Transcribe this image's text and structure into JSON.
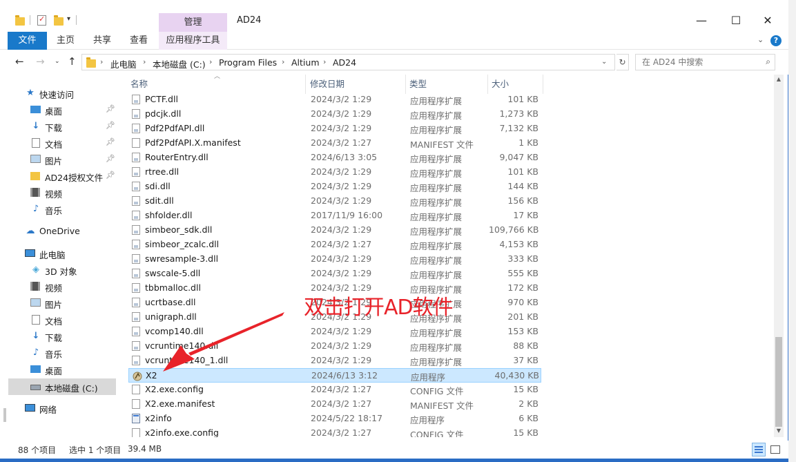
{
  "window": {
    "title": "AD24",
    "manage_tab": "管理",
    "minimize": "—",
    "maximize": "☐",
    "close": "✕"
  },
  "ribbon": {
    "tabs": [
      "文件",
      "主页",
      "共享",
      "查看"
    ],
    "app_tools": "应用程序工具",
    "help": "?"
  },
  "address": {
    "crumbs": [
      "此电脑",
      "本地磁盘 (C:)",
      "Program Files",
      "Altium",
      "AD24"
    ],
    "search_placeholder": "在 AD24 中搜索"
  },
  "navpane": {
    "items": [
      {
        "label": "快速访问",
        "icon": "star-icon"
      },
      {
        "label": "桌面",
        "icon": "desktop-icon"
      },
      {
        "label": "下载",
        "icon": "download-icon"
      },
      {
        "label": "文档",
        "icon": "document-icon"
      },
      {
        "label": "图片",
        "icon": "picture-icon"
      },
      {
        "label": "AD24授权文件",
        "icon": "folder-icon"
      },
      {
        "label": "视频",
        "icon": "video-icon"
      },
      {
        "label": "音乐",
        "icon": "music-icon"
      },
      {
        "label": "OneDrive",
        "icon": "cloud-icon"
      },
      {
        "label": "此电脑",
        "icon": "computer-icon"
      },
      {
        "label": "3D 对象",
        "icon": "cube-icon"
      },
      {
        "label": "视频",
        "icon": "video-icon"
      },
      {
        "label": "图片",
        "icon": "picture-icon"
      },
      {
        "label": "文档",
        "icon": "document-icon"
      },
      {
        "label": "下载",
        "icon": "download-icon"
      },
      {
        "label": "音乐",
        "icon": "music-icon"
      },
      {
        "label": "桌面",
        "icon": "desktop-icon"
      },
      {
        "label": "本地磁盘 (C:)",
        "icon": "drive-icon"
      },
      {
        "label": "网络",
        "icon": "network-icon"
      }
    ]
  },
  "columns": {
    "name": "名称",
    "date": "修改日期",
    "type": "类型",
    "size": "大小"
  },
  "files": [
    {
      "name": "PCTF.dll",
      "date": "2024/3/2 1:29",
      "type": "应用程序扩展",
      "size": "101 KB",
      "kind": "dll"
    },
    {
      "name": "pdcjk.dll",
      "date": "2024/3/2 1:29",
      "type": "应用程序扩展",
      "size": "1,273 KB",
      "kind": "dll"
    },
    {
      "name": "Pdf2PdfAPI.dll",
      "date": "2024/3/2 1:29",
      "type": "应用程序扩展",
      "size": "7,132 KB",
      "kind": "dll"
    },
    {
      "name": "Pdf2PdfAPI.X.manifest",
      "date": "2024/3/2 1:27",
      "type": "MANIFEST 文件",
      "size": "1 KB",
      "kind": "file"
    },
    {
      "name": "RouterEntry.dll",
      "date": "2024/6/13 3:05",
      "type": "应用程序扩展",
      "size": "9,047 KB",
      "kind": "dll"
    },
    {
      "name": "rtree.dll",
      "date": "2024/3/2 1:29",
      "type": "应用程序扩展",
      "size": "101 KB",
      "kind": "dll"
    },
    {
      "name": "sdi.dll",
      "date": "2024/3/2 1:29",
      "type": "应用程序扩展",
      "size": "144 KB",
      "kind": "dll"
    },
    {
      "name": "sdit.dll",
      "date": "2024/3/2 1:29",
      "type": "应用程序扩展",
      "size": "156 KB",
      "kind": "dll"
    },
    {
      "name": "shfolder.dll",
      "date": "2017/11/9 16:00",
      "type": "应用程序扩展",
      "size": "17 KB",
      "kind": "dll"
    },
    {
      "name": "simbeor_sdk.dll",
      "date": "2024/3/2 1:29",
      "type": "应用程序扩展",
      "size": "109,766 KB",
      "kind": "dll"
    },
    {
      "name": "simbeor_zcalc.dll",
      "date": "2024/3/2 1:27",
      "type": "应用程序扩展",
      "size": "4,153 KB",
      "kind": "dll"
    },
    {
      "name": "swresample-3.dll",
      "date": "2024/3/2 1:29",
      "type": "应用程序扩展",
      "size": "333 KB",
      "kind": "dll"
    },
    {
      "name": "swscale-5.dll",
      "date": "2024/3/2 1:29",
      "type": "应用程序扩展",
      "size": "555 KB",
      "kind": "dll"
    },
    {
      "name": "tbbmalloc.dll",
      "date": "2024/3/2 1:29",
      "type": "应用程序扩展",
      "size": "172 KB",
      "kind": "dll"
    },
    {
      "name": "ucrtbase.dll",
      "date": "2024/3/2 1:29",
      "type": "应用程序扩展",
      "size": "970 KB",
      "kind": "dll"
    },
    {
      "name": "unigraph.dll",
      "date": "2024/3/2 1:29",
      "type": "应用程序扩展",
      "size": "201 KB",
      "kind": "dll"
    },
    {
      "name": "vcomp140.dll",
      "date": "2024/3/2 1:29",
      "type": "应用程序扩展",
      "size": "153 KB",
      "kind": "dll"
    },
    {
      "name": "vcruntime140.dll",
      "date": "2024/3/2 1:29",
      "type": "应用程序扩展",
      "size": "88 KB",
      "kind": "dll"
    },
    {
      "name": "vcruntime140_1.dll",
      "date": "2024/3/2 1:29",
      "type": "应用程序扩展",
      "size": "37 KB",
      "kind": "dll"
    },
    {
      "name": "X2",
      "date": "2024/6/13 3:12",
      "type": "应用程序",
      "size": "40,430 KB",
      "kind": "x2",
      "selected": true
    },
    {
      "name": "X2.exe.config",
      "date": "2024/3/2 1:27",
      "type": "CONFIG 文件",
      "size": "15 KB",
      "kind": "file"
    },
    {
      "name": "X2.exe.manifest",
      "date": "2024/3/2 1:27",
      "type": "MANIFEST 文件",
      "size": "2 KB",
      "kind": "file"
    },
    {
      "name": "x2info",
      "date": "2024/5/22 18:17",
      "type": "应用程序",
      "size": "6 KB",
      "kind": "exe"
    },
    {
      "name": "x2info.exe.config",
      "date": "2024/3/2 1:27",
      "type": "CONFIG 文件",
      "size": "15 KB",
      "kind": "file"
    }
  ],
  "annotation": {
    "text": "双击打开AD软件",
    "color": "#e8232a"
  },
  "status": {
    "item_count": "88 个项目",
    "selected": "选中 1 个项目",
    "size": "39.4 MB"
  },
  "colors": {
    "accent": "#1979ca",
    "selection": "#cce8ff",
    "manage_tab": "#e8d3f1"
  }
}
